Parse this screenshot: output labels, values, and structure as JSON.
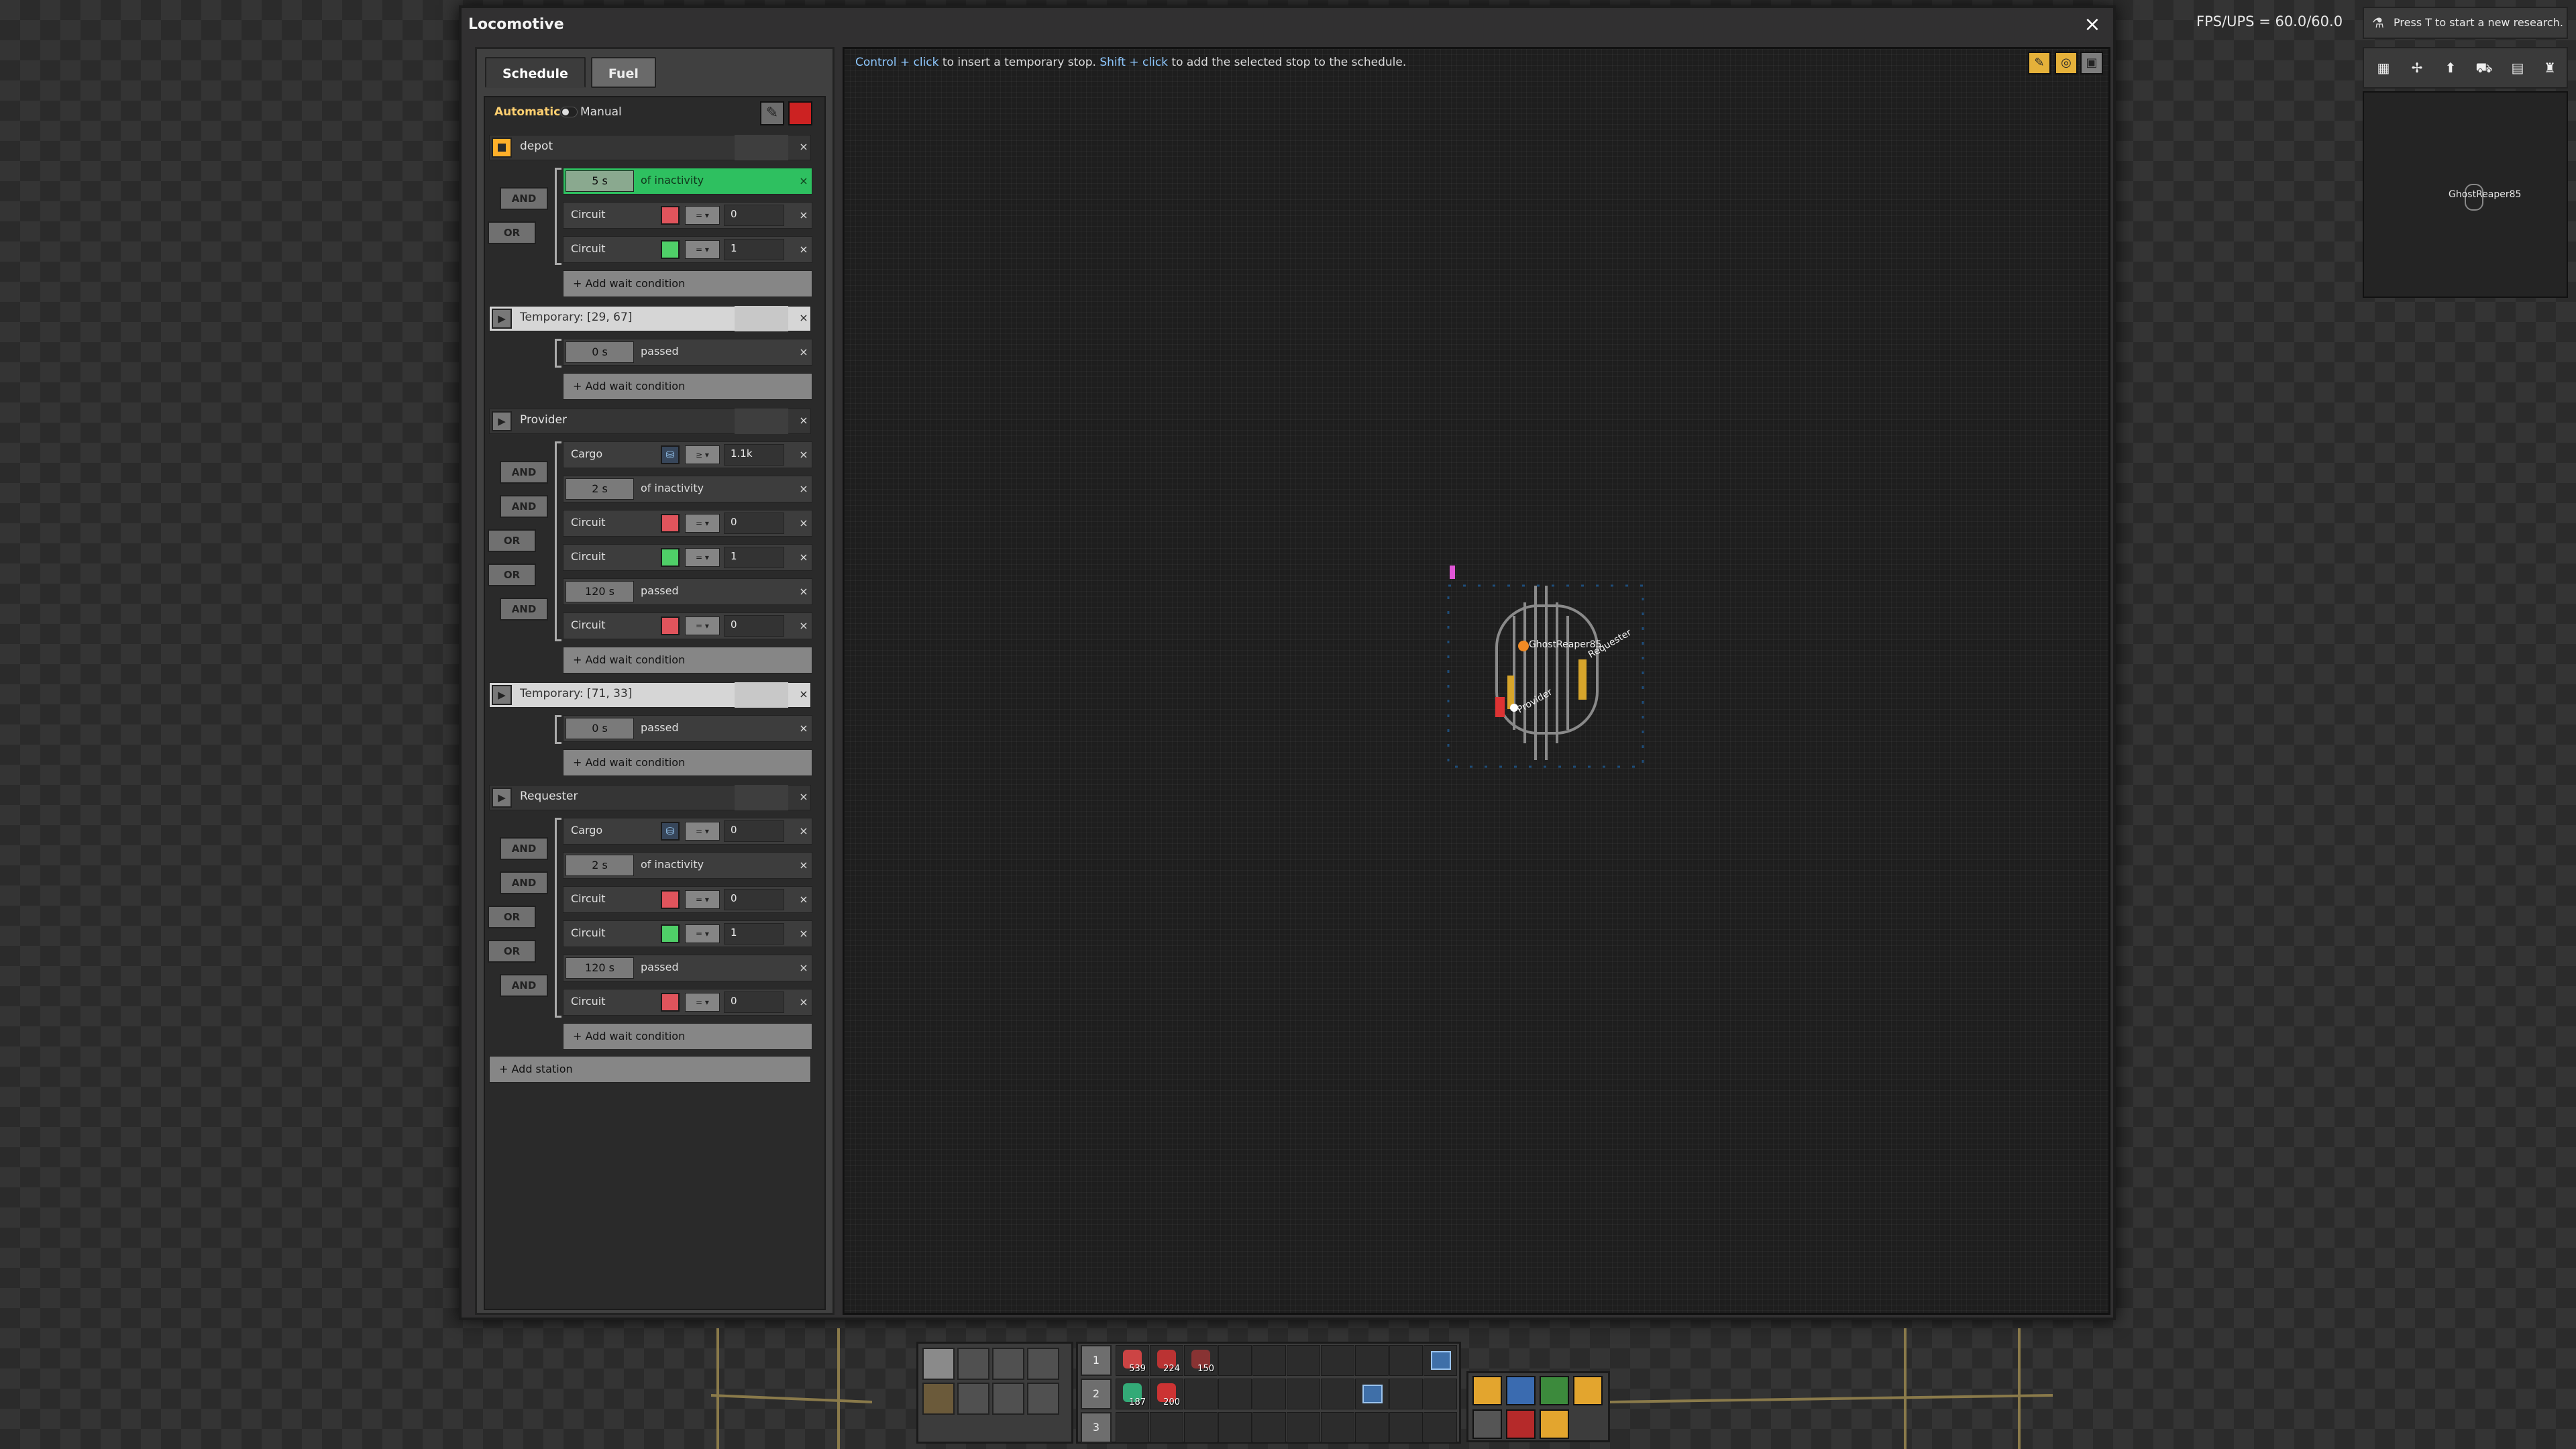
{
  "window": {
    "title": "Locomotive",
    "close_glyph": "×"
  },
  "tabs": [
    {
      "label": "Schedule"
    },
    {
      "label": "Fuel"
    }
  ],
  "mode": {
    "automatic": "Automatic",
    "manual": "Manual"
  },
  "stations": [
    {
      "name": "depot",
      "temporary": false,
      "conditions": [
        {
          "type": "inactivity",
          "time": "5 s",
          "text": "of inactivity",
          "active": true
        },
        {
          "type": "circuit",
          "label": "Circuit",
          "signal": "red",
          "cmp": "= ▾",
          "value": "0",
          "logic": "AND"
        },
        {
          "type": "circuit",
          "label": "Circuit",
          "signal": "green",
          "cmp": "= ▾",
          "value": "1",
          "logic": "OR"
        }
      ]
    },
    {
      "name": "Temporary: [29, 67]",
      "temporary": true,
      "conditions": [
        {
          "type": "time",
          "time": "0 s",
          "text": "passed"
        }
      ]
    },
    {
      "name": "Provider",
      "temporary": false,
      "conditions": [
        {
          "type": "cargo",
          "label": "Cargo",
          "signal": "cargo",
          "cmp": "≥ ▾",
          "value": "1.1k"
        },
        {
          "type": "inactivity",
          "time": "2 s",
          "text": "of inactivity",
          "logic": "AND"
        },
        {
          "type": "circuit",
          "label": "Circuit",
          "signal": "red",
          "cmp": "= ▾",
          "value": "0",
          "logic": "AND"
        },
        {
          "type": "circuit",
          "label": "Circuit",
          "signal": "green",
          "cmp": "= ▾",
          "value": "1",
          "logic": "OR"
        },
        {
          "type": "time",
          "time": "120 s",
          "text": "passed",
          "logic": "OR"
        },
        {
          "type": "circuit",
          "label": "Circuit",
          "signal": "red",
          "cmp": "= ▾",
          "value": "0",
          "logic": "AND"
        }
      ]
    },
    {
      "name": "Temporary: [71, 33]",
      "temporary": true,
      "conditions": [
        {
          "type": "time",
          "time": "0 s",
          "text": "passed"
        }
      ]
    },
    {
      "name": "Requester",
      "temporary": false,
      "conditions": [
        {
          "type": "cargo",
          "label": "Cargo",
          "signal": "cargo",
          "cmp": "= ▾",
          "value": "0"
        },
        {
          "type": "inactivity",
          "time": "2 s",
          "text": "of inactivity",
          "logic": "AND"
        },
        {
          "type": "circuit",
          "label": "Circuit",
          "signal": "red",
          "cmp": "= ▾",
          "value": "0",
          "logic": "AND"
        },
        {
          "type": "circuit",
          "label": "Circuit",
          "signal": "green",
          "cmp": "= ▾",
          "value": "1",
          "logic": "OR"
        },
        {
          "type": "time",
          "time": "120 s",
          "text": "passed",
          "logic": "OR"
        },
        {
          "type": "circuit",
          "label": "Circuit",
          "signal": "red",
          "cmp": "= ▾",
          "value": "0",
          "logic": "AND"
        }
      ]
    }
  ],
  "add_wait_condition": "+ Add wait condition",
  "add_station": "+ Add station",
  "map": {
    "hint_ctrl": "Control + click",
    "hint_mid": " to insert a temporary stop. ",
    "hint_shift": "Shift + click",
    "hint_end": " to add the selected stop to the schedule.",
    "labels": {
      "player": "GhostReaper85",
      "requester": "Requester",
      "provider": "Provider"
    }
  },
  "hud": {
    "fps": "FPS/UPS = 60.0/60.0",
    "research": "Press T to start a new research.",
    "minimap_player": "GhostReaper85"
  },
  "quickbar": {
    "rows": [
      "1",
      "2",
      "3"
    ],
    "counts": [
      "539",
      "224",
      "150",
      "187",
      "200"
    ]
  },
  "colors": {
    "accent": "#ffb02a",
    "active_condition": "#2ec060",
    "stop": "#cc2222"
  },
  "icons": [
    "close-icon",
    "rename-icon",
    "flask-icon",
    "cargo-icon",
    "play-icon"
  ]
}
